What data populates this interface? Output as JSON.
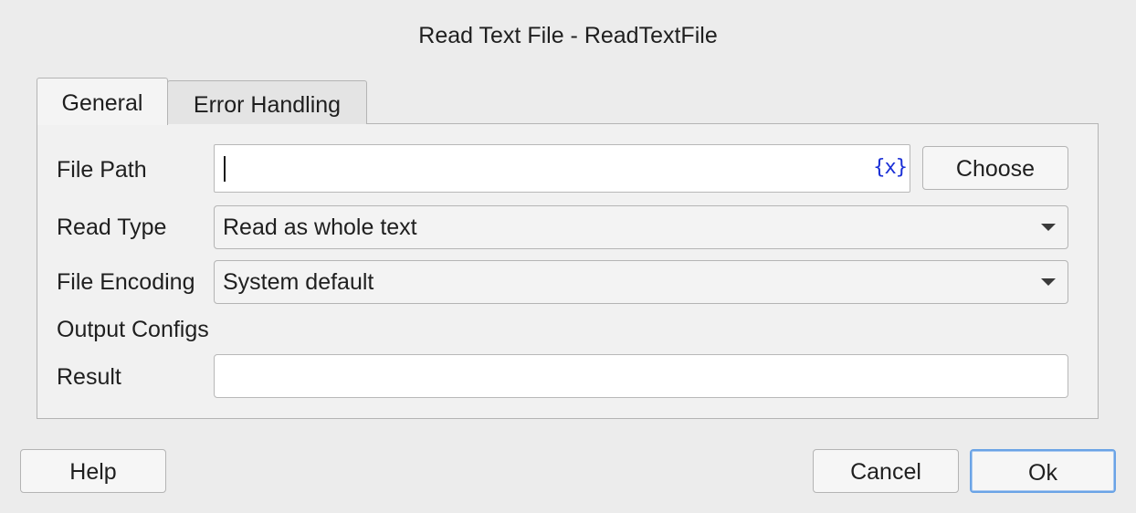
{
  "dialog": {
    "title": "Read Text File - ReadTextFile"
  },
  "tabs": [
    {
      "label": "General",
      "active": true
    },
    {
      "label": "Error Handling",
      "active": false
    }
  ],
  "form": {
    "file_path": {
      "label": "File Path",
      "value": "",
      "variable_icon": "{x}",
      "choose_label": "Choose"
    },
    "read_type": {
      "label": "Read Type",
      "selected": "Read as whole text"
    },
    "file_encoding": {
      "label": "File Encoding",
      "selected": "System default"
    },
    "output_section": {
      "label": "Output Configs"
    },
    "result": {
      "label": "Result",
      "value": ""
    }
  },
  "footer": {
    "help_label": "Help",
    "cancel_label": "Cancel",
    "ok_label": "Ok"
  },
  "colors": {
    "background": "#ececec",
    "variable_icon": "#1a2fd6",
    "default_button_focus": "#6aa3e6"
  }
}
